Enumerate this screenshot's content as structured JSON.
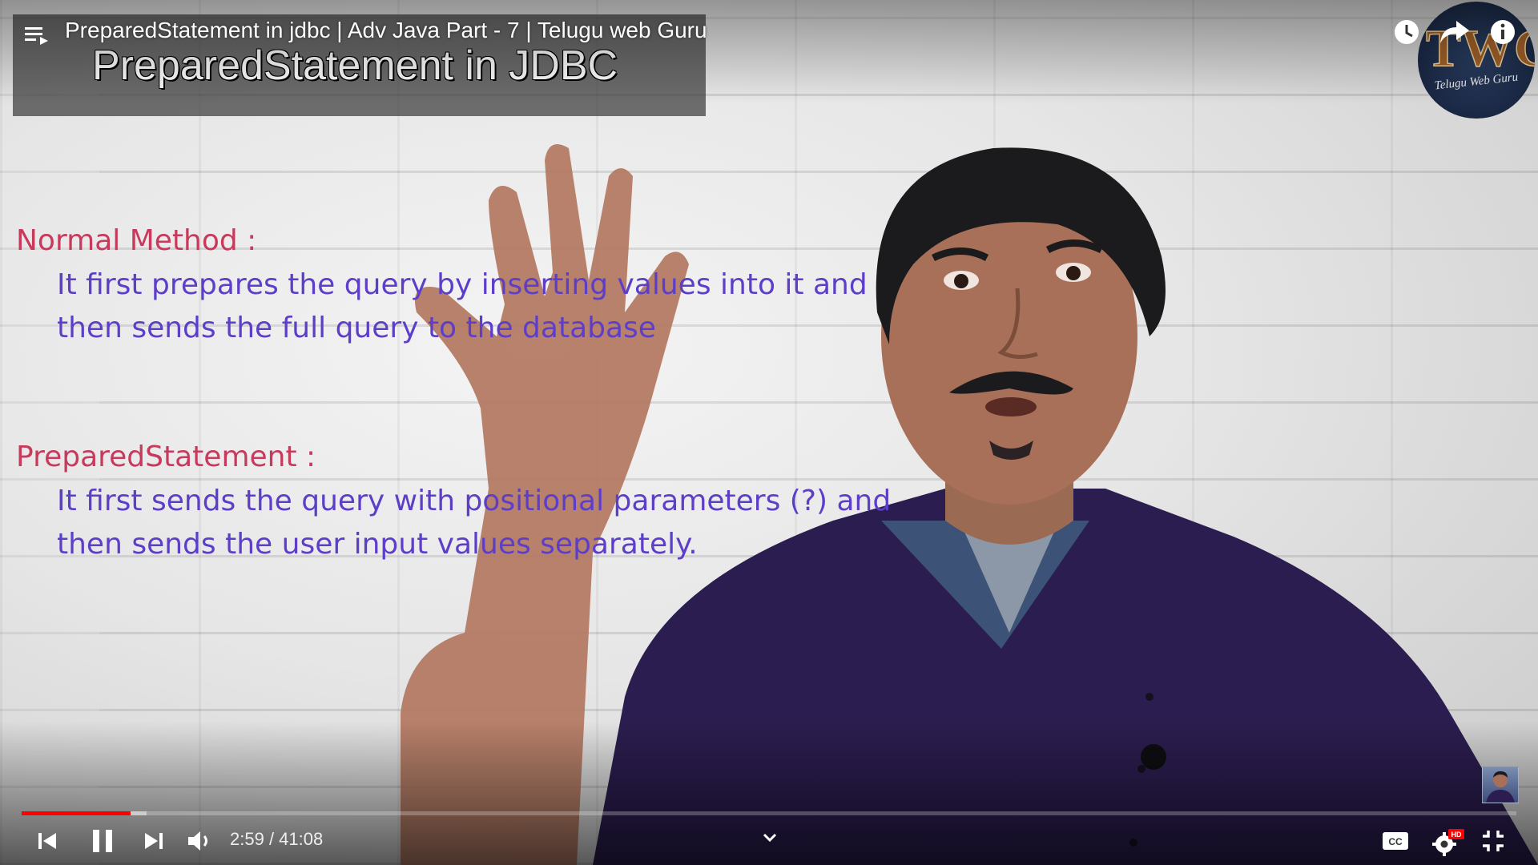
{
  "player": {
    "title": "PreparedStatement in jdbc | Adv Java Part - 7 | Telugu web Guru",
    "time": {
      "current": "2:59",
      "separator": " / ",
      "duration": "41:08"
    },
    "progress": {
      "played_fraction": 0.0727,
      "buffered_fraction": 0.0835
    },
    "settings_badge": "HD",
    "accent_color": "#ff0000"
  },
  "video": {
    "banner_title": "PreparedStatement in JDBC",
    "channel_logo_text": "Telugu Web Guru",
    "slide": {
      "normal_heading": "Normal Method :",
      "normal_line1": "It first prepares the query by inserting values into it and",
      "normal_line2": "then sends the full query to the database",
      "prepared_heading": "PreparedStatement :",
      "prepared_line1": "It first sends the query with positional parameters (?) and",
      "prepared_line2": "then sends the user input values separately."
    },
    "colors": {
      "heading": "#c83a5c",
      "text": "#5d3ec9"
    }
  },
  "icons": {
    "playlist": "playlist-icon",
    "watch_later": "clock-icon",
    "share": "share-arrow-icon",
    "info": "info-icon",
    "prev": "skip-previous-icon",
    "pause": "pause-icon",
    "next": "skip-next-icon",
    "volume": "volume-icon",
    "expand": "chevron-down-icon",
    "captions": "cc-icon",
    "settings": "gear-icon",
    "exit_fullscreen": "exit-fullscreen-icon"
  }
}
